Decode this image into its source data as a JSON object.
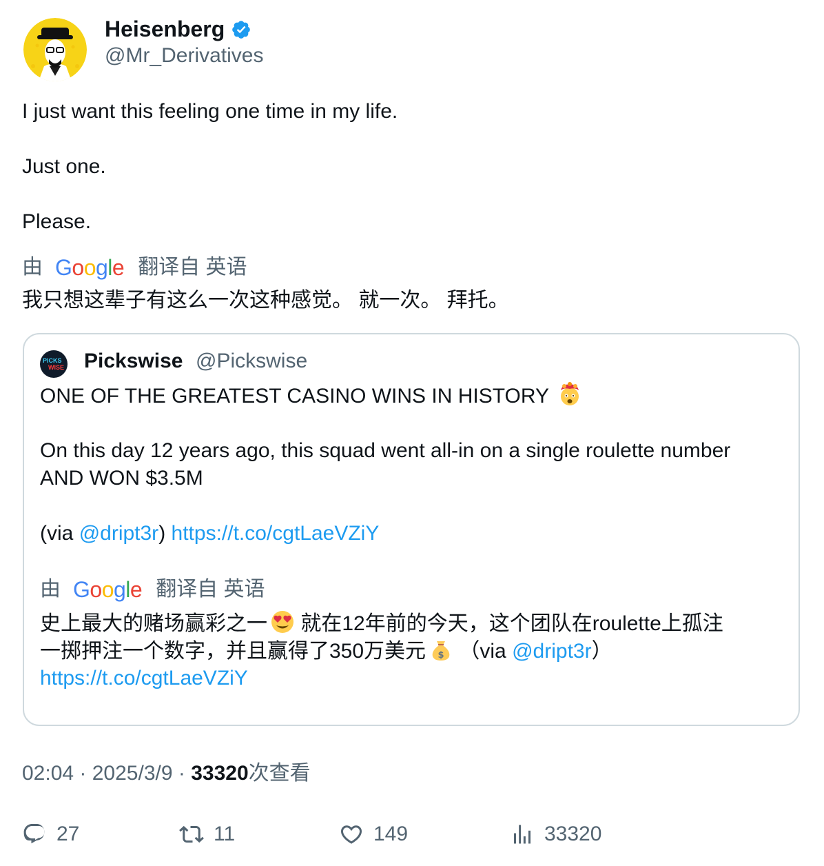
{
  "author": {
    "name": "Heisenberg",
    "handle": "@Mr_Derivatives",
    "verified_color": "#1d9bf0"
  },
  "tweet": {
    "lines": [
      "I just want this feeling one time in my life.",
      "Just one.",
      "Please."
    ]
  },
  "translation": {
    "prefix": "由",
    "provider": "Google",
    "suffix": "翻译自 英语",
    "text": "我只想这辈子有这么一次这种感觉。 就一次。 拜托。"
  },
  "quote": {
    "author_name": "Pickswise",
    "author_handle": "@Pickswise",
    "avatar_text_1": "PICKS",
    "avatar_text_2": "WISE",
    "line1": "ONE OF THE GREATEST CASINO WINS IN HISTORY",
    "line1_emoji": "exploding-head-emoji",
    "line2": "On this day 12 years ago, this squad went all-in on a single roulette number",
    "line3": "AND WON $3.5M",
    "via_open": "(via ",
    "via_mention": "@dript3r",
    "via_close": ")",
    "link": "https://t.co/cgtLaeVZiY",
    "translation": {
      "prefix": "由",
      "provider": "Google",
      "suffix": "翻译自 英语",
      "line1_a": "史上最大的赌场赢彩之一",
      "line1_emoji": "heart-eyes-emoji",
      "line1_b": " 就在12年前的今天，这个团队在roulette上孤注",
      "line2_a": "一掷押注一个数字，并且赢得了350万美元",
      "line2_emoji": "money-bag-emoji",
      "line2_b": " （via ",
      "line2_mention": "@dript3r",
      "line2_close": "）",
      "line3_link": "https://t.co/cgtLaeVZiY"
    }
  },
  "meta": {
    "time": "02:04",
    "sep": " · ",
    "date": "2025/3/9",
    "views": "33320",
    "views_suffix": "次查看"
  },
  "actions": {
    "replies": "27",
    "retweets": "11",
    "likes": "149",
    "views": "33320"
  },
  "colors": {
    "link": "#1d9bf0",
    "secondary_text": "#536471",
    "border": "#cfd9de",
    "google_blue": "#4285f4",
    "google_red": "#ea4335",
    "google_yellow": "#fbbc05",
    "google_green": "#34a853"
  }
}
